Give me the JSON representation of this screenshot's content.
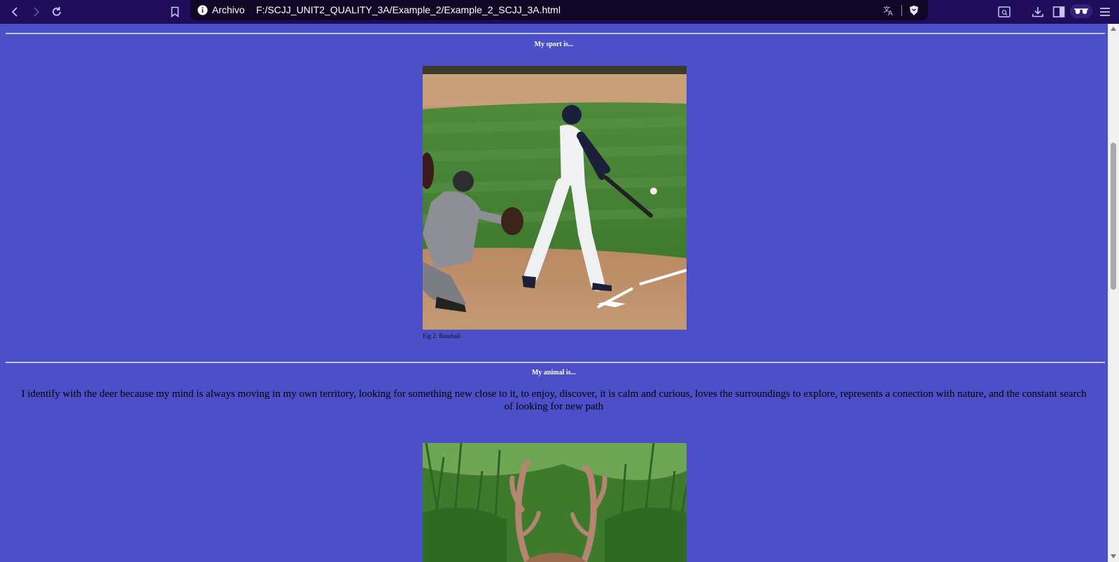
{
  "browser": {
    "address_scheme": "Archivo",
    "url": "F:/SCJJ_UNIT2_QUALITY_3A/Example_2/Example_2_SCJJ_3A.html",
    "icons": [
      "back-icon",
      "forward-icon",
      "reload-icon",
      "bookmark-icon",
      "info-icon",
      "translate-icon",
      "brave-shield-icon",
      "reader-mode-icon",
      "download-icon",
      "sidebar-icon",
      "private-glasses-icon",
      "menu-icon"
    ]
  },
  "page": {
    "sport_title": "My sport is...",
    "sport_caption": "Fig 2. Baseball",
    "animal_title": "My animal is...",
    "animal_text": "I identify with the deer because my mind is always moving in my own territory, looking for something new close to it, to enjoy, discover, it is calm and curious, loves the surroundings to explore, represents a conection with nature, and the constant search of looking for new path"
  },
  "colors": {
    "page_background": "#4b4fc8",
    "toolbar": "#1f0d5c",
    "address_bar": "#100726"
  }
}
